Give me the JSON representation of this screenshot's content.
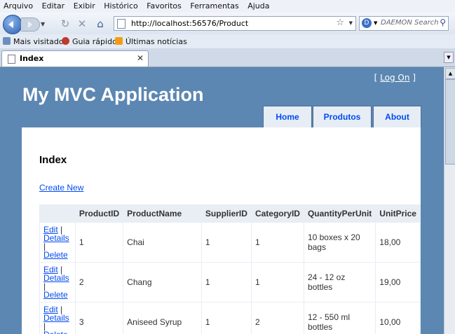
{
  "menu_bar": [
    "Arquivo",
    "Editar",
    "Exibir",
    "Histórico",
    "Favoritos",
    "Ferramentas",
    "Ajuda"
  ],
  "address_bar": {
    "url": "http://localhost:56576/Product"
  },
  "search_box": {
    "placeholder": "DAEMON Search"
  },
  "bookmarks": [
    "Mais visitados",
    "Guia rápido",
    "Últimas notícias"
  ],
  "tab": {
    "title": "Index"
  },
  "site": {
    "logon_open": "[",
    "logon_link": "Log On",
    "logon_close": "]",
    "title": "My MVC Application",
    "menu": [
      "Home",
      "Produtos",
      "About"
    ]
  },
  "page": {
    "heading": "Index",
    "create_new": "Create New",
    "table": {
      "headers": [
        "",
        "ProductID",
        "ProductName",
        "SupplierID",
        "CategoryID",
        "QuantityPerUnit",
        "UnitPrice"
      ],
      "action_labels": {
        "edit": "Edit",
        "details": "Details",
        "delete": "Delete",
        "sep": "|"
      },
      "rows": [
        [
          "1",
          "Chai",
          "1",
          "1",
          "10 boxes x 20 bags",
          "18,00"
        ],
        [
          "2",
          "Chang",
          "1",
          "1",
          "24 - 12 oz bottles",
          "19,00"
        ],
        [
          "3",
          "Aniseed Syrup",
          "1",
          "2",
          "12 - 550 ml bottles",
          "10,00"
        ]
      ]
    }
  },
  "colors": {
    "page_background": "#5c87b2",
    "link": "#034af3",
    "table_header": "#e8eef4"
  }
}
